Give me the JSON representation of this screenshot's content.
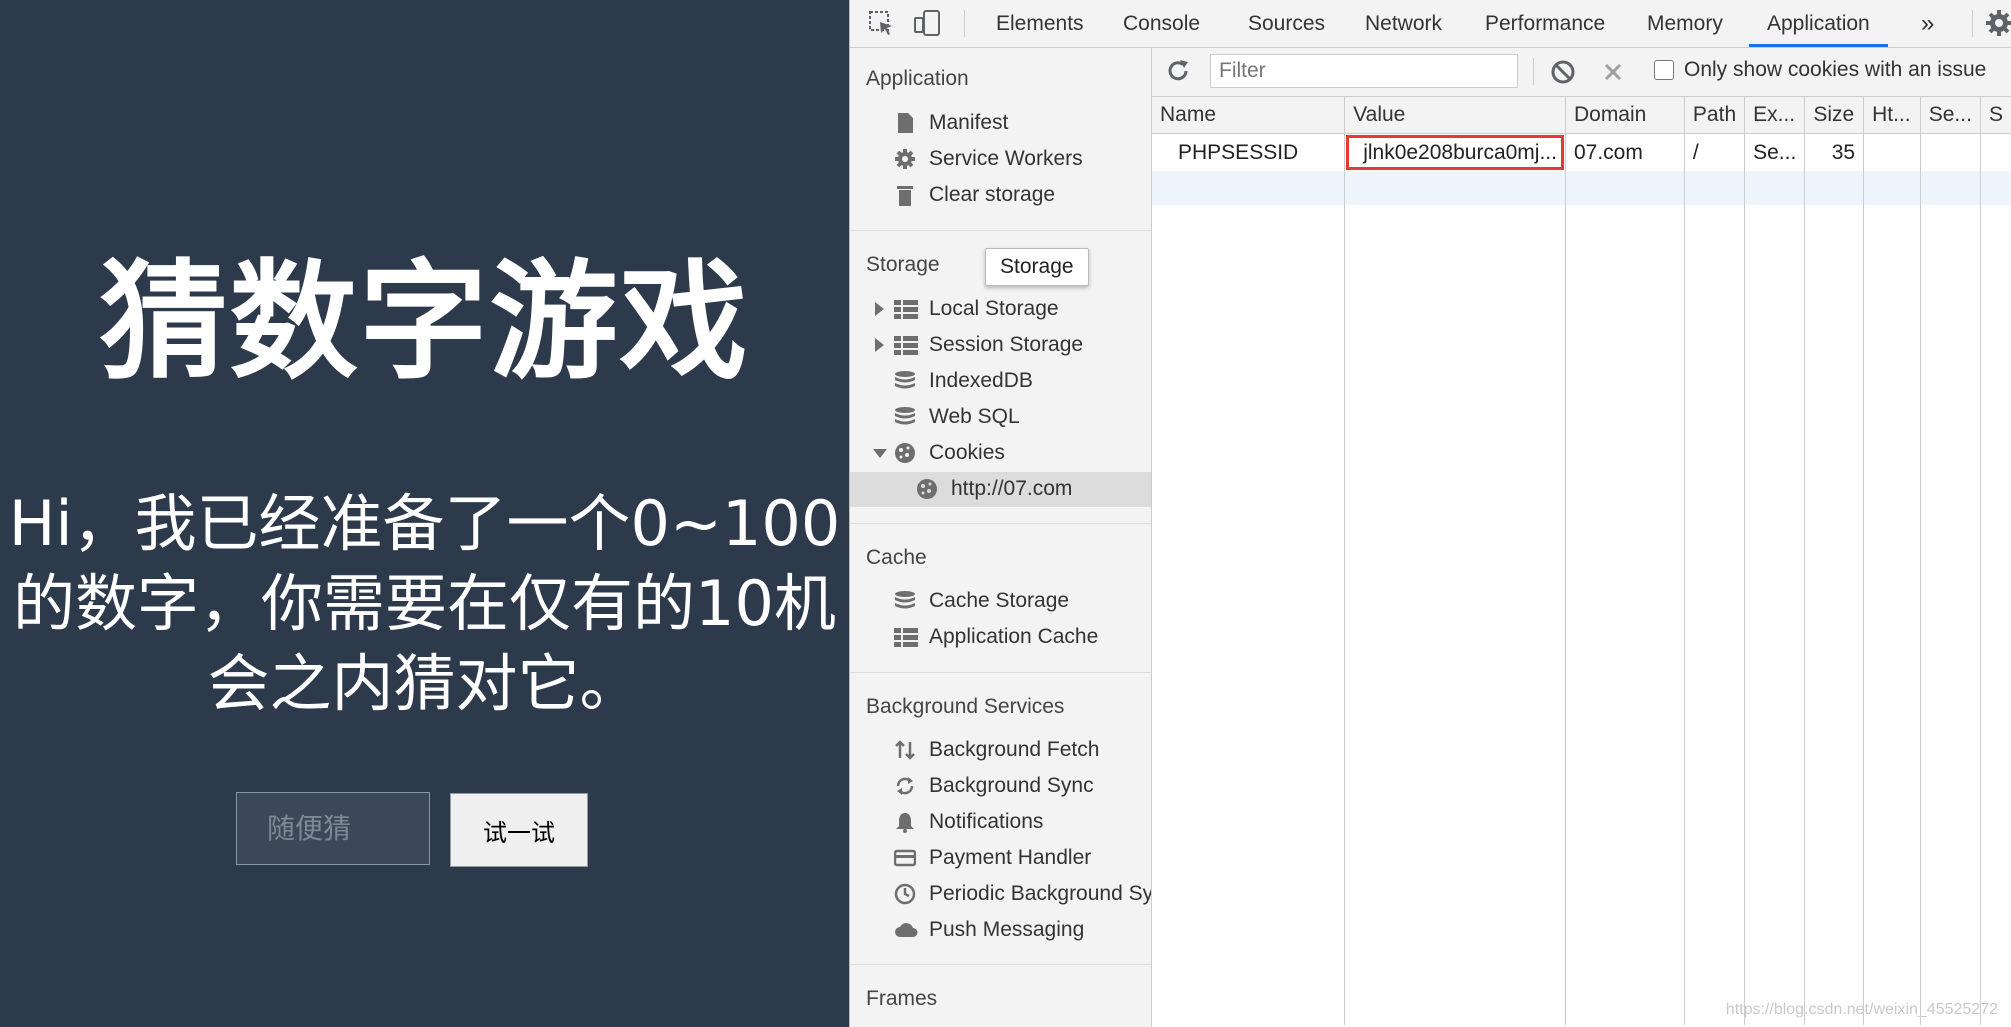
{
  "page": {
    "title": "猜数字游戏",
    "description": "Hi，我已经准备了一个0~100的数字，你需要在仅有的10机会之内猜对它。",
    "input_placeholder": "随便猜",
    "submit_label": "试一试"
  },
  "devtools": {
    "tabs": [
      "Elements",
      "Console",
      "Sources",
      "Network",
      "Performance",
      "Memory",
      "Application"
    ],
    "active_tab": "Application",
    "more_tabs_glyph": "»",
    "sidebar": {
      "application_title": "Application",
      "application_items": [
        "Manifest",
        "Service Workers",
        "Clear storage"
      ],
      "storage_title": "Storage",
      "storage_items": [
        "Local Storage",
        "Session Storage",
        "IndexedDB",
        "Web SQL",
        "Cookies"
      ],
      "cookie_origin": "http://07.com",
      "cache_title": "Cache",
      "cache_items": [
        "Cache Storage",
        "Application Cache"
      ],
      "background_title": "Background Services",
      "background_items": [
        "Background Fetch",
        "Background Sync",
        "Notifications",
        "Payment Handler",
        "Periodic Background Sync",
        "Push Messaging"
      ],
      "frames_title": "Frames",
      "tooltip": "Storage"
    },
    "toolbar": {
      "filter_placeholder": "Filter",
      "only_issue_label": "Only show cookies with an issue",
      "only_issue_checked": false
    },
    "cookie_table": {
      "columns": [
        "Name",
        "Value",
        "Domain",
        "Path",
        "Ex...",
        "Size",
        "Ht...",
        "Se...",
        "S"
      ],
      "rows": [
        {
          "name": "PHPSESSID",
          "value": "jlnk0e208burca0mj...",
          "domain": "07.com",
          "path": "/",
          "expires": "Se...",
          "size": "35",
          "httponly": "",
          "secure": "",
          "samesite": ""
        }
      ]
    }
  },
  "watermark": "https://blog.csdn.net/weixin_45525272",
  "colors": {
    "page_bg": "#2c3a4b",
    "highlight": "#e53935",
    "active_tab": "#1a73e8"
  }
}
